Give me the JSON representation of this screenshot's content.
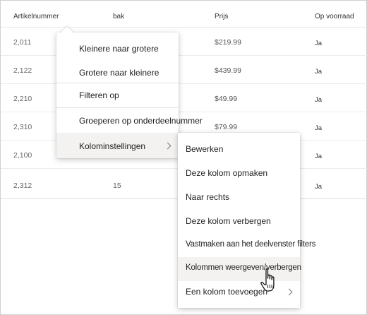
{
  "columns": {
    "artikelnummer": "Artikelnummer",
    "bak": "bak",
    "prijs": "Prijs",
    "op_voorraad": "Op voorraad"
  },
  "rows": [
    {
      "artikelnummer": "2,011",
      "bak": "",
      "prijs": "$219.99",
      "op_voorraad": "Ja"
    },
    {
      "artikelnummer": "2,122",
      "bak": "",
      "prijs": "$439.99",
      "op_voorraad": "Ja"
    },
    {
      "artikelnummer": "2,210",
      "bak": "",
      "prijs": "$49.99",
      "op_voorraad": "Ja"
    },
    {
      "artikelnummer": "2,310",
      "bak": "",
      "prijs": "$79.99",
      "op_voorraad": "Ja"
    },
    {
      "artikelnummer": "2,100",
      "bak": "",
      "prijs": "",
      "op_voorraad": "Ja"
    },
    {
      "artikelnummer": "2,312",
      "bak": "15",
      "prijs": "",
      "op_voorraad": "Ja"
    }
  ],
  "column_menu": {
    "sort_ascending": "Kleinere naar grotere",
    "sort_descending": "Grotere naar kleinere",
    "filter": "Filteren op",
    "group": "Groeperen op onderdeelnummer",
    "column_settings": "Kolominstellingen"
  },
  "column_settings_menu": {
    "edit": "Bewerken",
    "format": "Deze kolom opmaken",
    "move_right": "Naar rechts",
    "hide": "Deze kolom verbergen",
    "pin": "Vastmaken aan het deelvenster filters",
    "show_hide": "Kolommen weergeven/verbergen",
    "add": "Een kolom toevoegen"
  },
  "icons": {
    "submenu_chevron": "chevron-right-icon",
    "cursor": "hand-pointer-cursor"
  },
  "colors": {
    "highlight": "#f3f2f1",
    "divider": "#e1e1e1",
    "text": "#222222"
  }
}
